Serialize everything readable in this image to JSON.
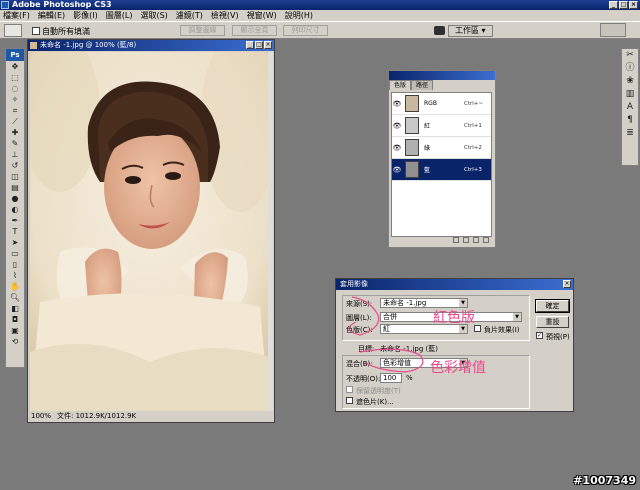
{
  "app": {
    "title": "Adobe Photoshop CS3"
  },
  "menu": [
    "檔案(F)",
    "編輯(E)",
    "影像(I)",
    "圖層(L)",
    "選取(S)",
    "濾鏡(T)",
    "檢視(V)",
    "視窗(W)",
    "說明(H)"
  ],
  "options": {
    "checkbox_label": "自動所有填滿",
    "btn1": "調整邊緣",
    "btn2": "顯示全頁",
    "btn3": "列印尺寸",
    "workspace": "工作區 ▾"
  },
  "document": {
    "title": "未命名 -1.jpg @ 100% (藍/8)",
    "zoom": "100%",
    "doc_size": "文件: 1012.9K/1012.9K"
  },
  "channels": {
    "tab1": "色版",
    "tab2": "路徑",
    "rows": [
      {
        "name": "RGB",
        "shortcut": "Ctrl+~",
        "selected": false
      },
      {
        "name": "紅",
        "shortcut": "Ctrl+1",
        "selected": false
      },
      {
        "name": "綠",
        "shortcut": "Ctrl+2",
        "selected": false
      },
      {
        "name": "藍",
        "shortcut": "Ctrl+3",
        "selected": true
      }
    ]
  },
  "dialog": {
    "title": "套用影像",
    "source_label": "來源(S):",
    "source_value": "未命名 -1.jpg",
    "layer_label": "圖層(L):",
    "layer_value": "合併",
    "channel_label": "色版(C):",
    "channel_value": "紅",
    "invert_label": "負片效果(I)",
    "target_label": "目標:",
    "target_value": "未命名 -1.jpg (藍)",
    "blend_label": "混合(B):",
    "blend_value": "色彩增值",
    "opacity_label": "不透明(O):",
    "opacity_value": "100",
    "opacity_unit": "%",
    "preserve_label": "保留透明度(T)",
    "mask_label": "遮色片(K)...",
    "ok": "確定",
    "reset": "重設",
    "preview_label": "預視(P)"
  },
  "annotations": {
    "red_channel": "紅色版",
    "multiply": "色彩增值"
  },
  "watermark": "#1007349",
  "colors": {
    "selection": "#0a246a",
    "annotation": "#e84a8a"
  }
}
